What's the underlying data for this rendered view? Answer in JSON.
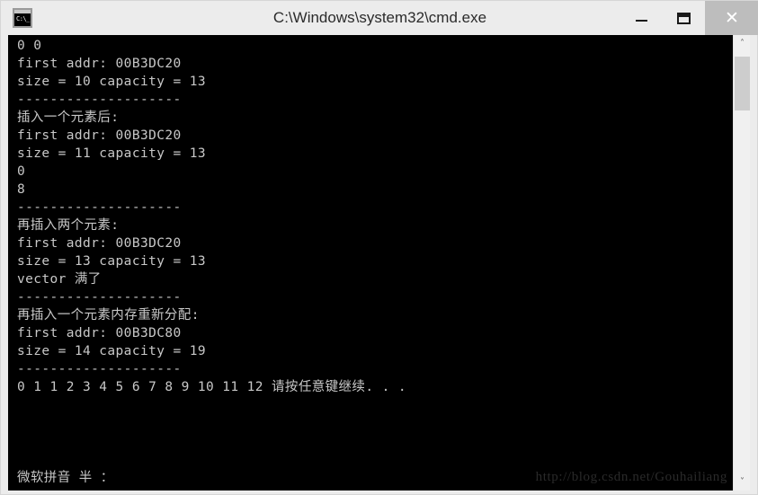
{
  "window": {
    "title": "C:\\Windows\\system32\\cmd.exe",
    "icon": "cmd-console-icon",
    "icon_prompt": "C:\\_",
    "bg_color": "#ececec",
    "console_bg": "#000000",
    "console_fg": "#c8c8c8"
  },
  "titlebar": {
    "minimize_label": "—",
    "maximize_label": "❐",
    "close_label": "✕"
  },
  "console": {
    "lines": [
      "0 0",
      "first addr: 00B3DC20",
      "size = 10 capacity = 13",
      "--------------------",
      "插入一个元素后:",
      "first addr: 00B3DC20",
      "size = 11 capacity = 13",
      "0",
      "8",
      "--------------------",
      "再插入两个元素:",
      "first addr: 00B3DC20",
      "size = 13 capacity = 13",
      "vector 满了",
      "--------------------",
      "再插入一个元素内存重新分配:",
      "first addr: 00B3DC80",
      "size = 14 capacity = 19",
      "--------------------",
      "0 1 1 2 3 4 5 6 7 8 9 10 11 12 请按任意键继续. . ."
    ],
    "ime_status": "微软拼音 半 ：",
    "watermark": "http://blog.csdn.net/Gouhailiang"
  },
  "scrollbar": {
    "up_arrow": "˄",
    "down_arrow": "˅"
  }
}
